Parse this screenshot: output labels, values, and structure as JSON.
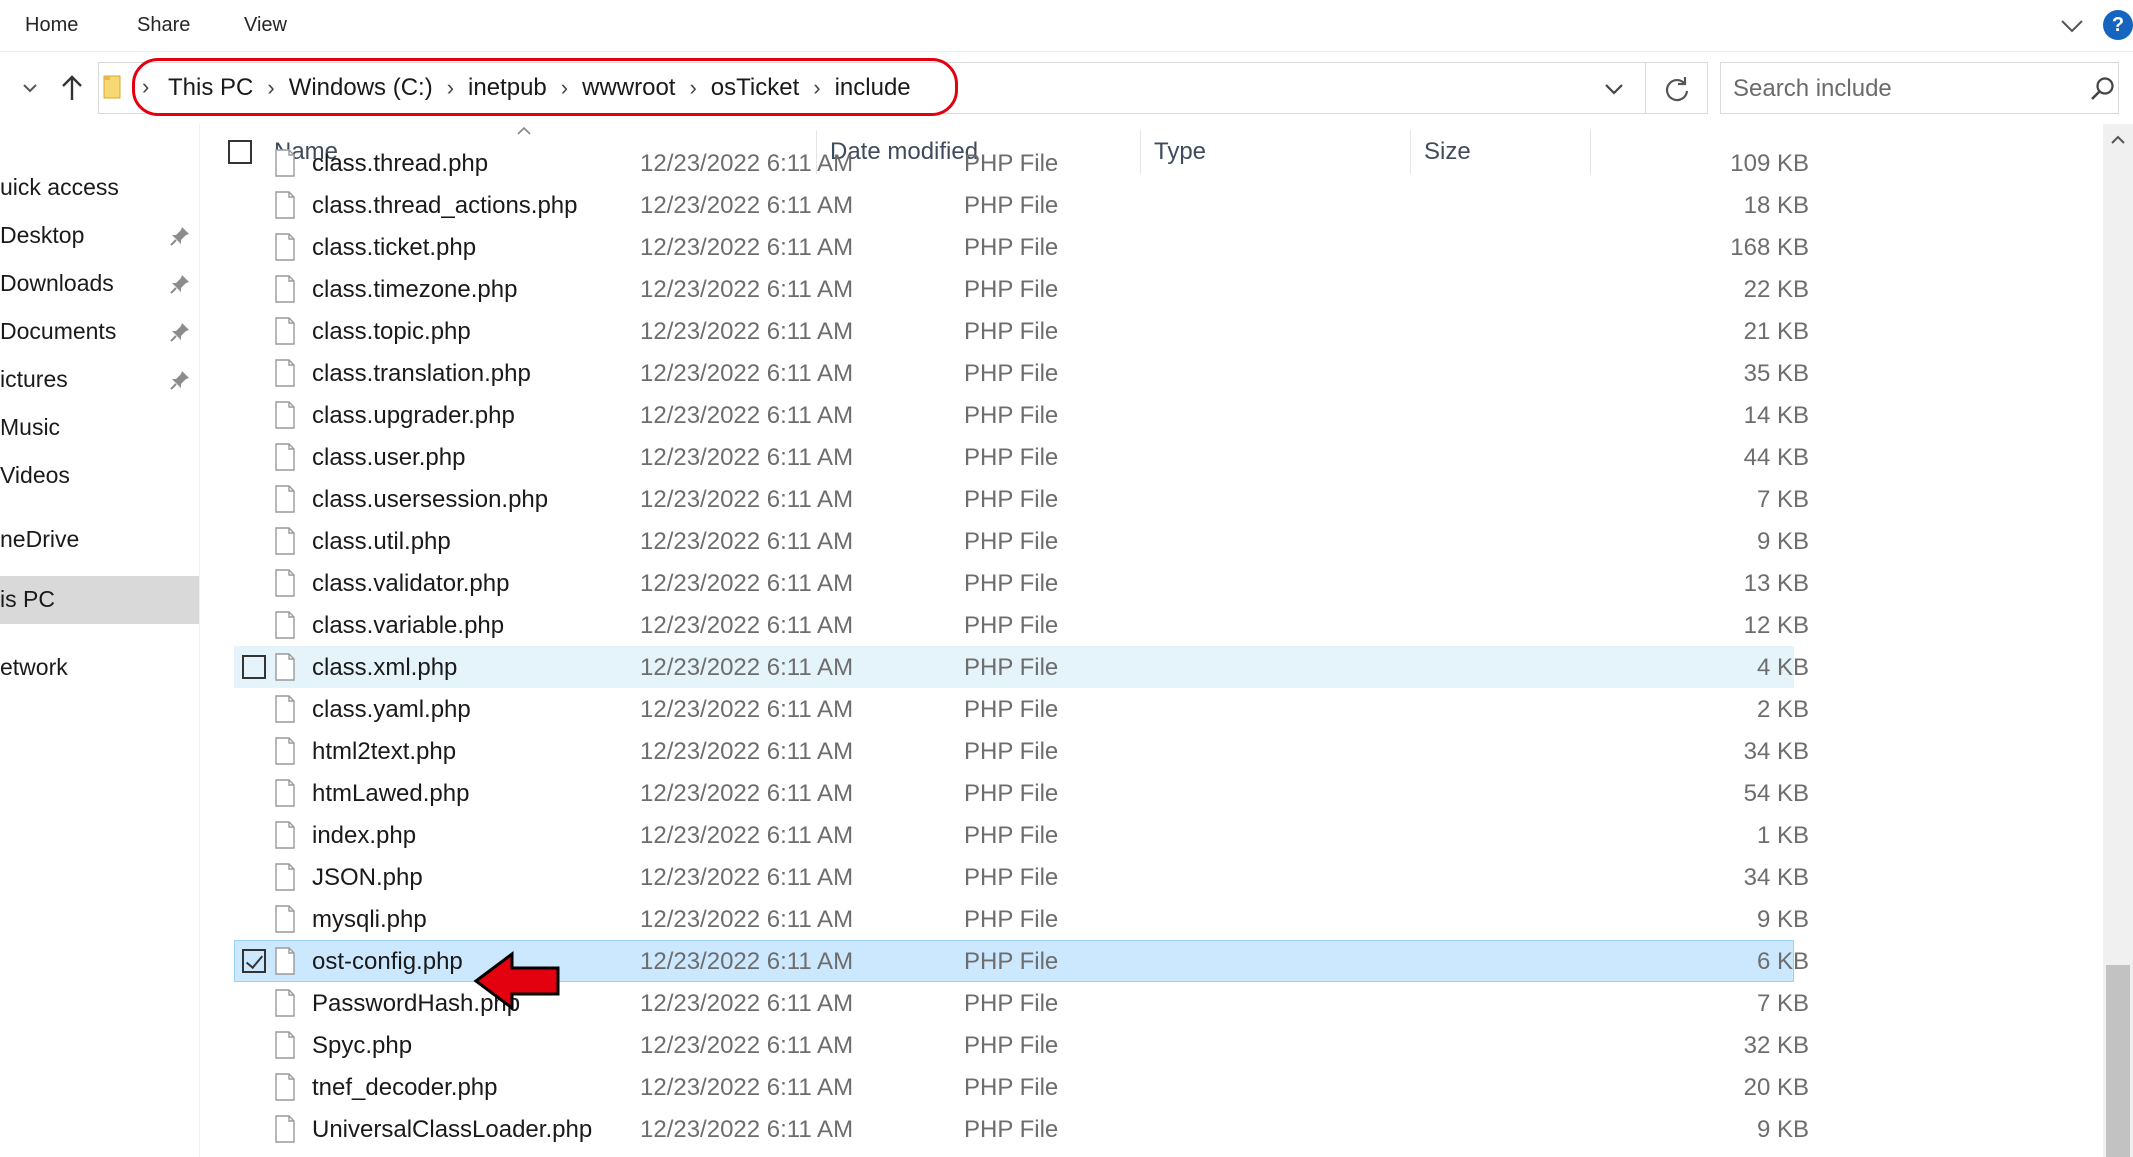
{
  "ribbon": {
    "tabs": [
      "Home",
      "Share",
      "View"
    ],
    "help_label": "?"
  },
  "address": {
    "breadcrumbs": [
      "This PC",
      "Windows (C:)",
      "inetpub",
      "wwwroot",
      "osTicket",
      "include"
    ]
  },
  "search": {
    "placeholder": "Search include"
  },
  "sidebar": {
    "items": [
      {
        "label": "uick access",
        "pinned": false
      },
      {
        "label": "Desktop",
        "pinned": true
      },
      {
        "label": "Downloads",
        "pinned": true
      },
      {
        "label": "Documents",
        "pinned": true
      },
      {
        "label": "ictures",
        "pinned": true
      },
      {
        "label": "Music",
        "pinned": false
      },
      {
        "label": "Videos",
        "pinned": false
      },
      {
        "label": "neDrive",
        "pinned": false
      },
      {
        "label": "is PC",
        "pinned": false,
        "selected": true
      },
      {
        "label": "etwork",
        "pinned": false
      }
    ]
  },
  "columns": {
    "name": "Name",
    "date": "Date modified",
    "type": "Type",
    "size": "Size"
  },
  "files": [
    {
      "name": "class.thread.php",
      "date": "12/23/2022 6:11 AM",
      "type": "PHP File",
      "size": "109 KB"
    },
    {
      "name": "class.thread_actions.php",
      "date": "12/23/2022 6:11 AM",
      "type": "PHP File",
      "size": "18 KB"
    },
    {
      "name": "class.ticket.php",
      "date": "12/23/2022 6:11 AM",
      "type": "PHP File",
      "size": "168 KB"
    },
    {
      "name": "class.timezone.php",
      "date": "12/23/2022 6:11 AM",
      "type": "PHP File",
      "size": "22 KB"
    },
    {
      "name": "class.topic.php",
      "date": "12/23/2022 6:11 AM",
      "type": "PHP File",
      "size": "21 KB"
    },
    {
      "name": "class.translation.php",
      "date": "12/23/2022 6:11 AM",
      "type": "PHP File",
      "size": "35 KB"
    },
    {
      "name": "class.upgrader.php",
      "date": "12/23/2022 6:11 AM",
      "type": "PHP File",
      "size": "14 KB"
    },
    {
      "name": "class.user.php",
      "date": "12/23/2022 6:11 AM",
      "type": "PHP File",
      "size": "44 KB"
    },
    {
      "name": "class.usersession.php",
      "date": "12/23/2022 6:11 AM",
      "type": "PHP File",
      "size": "7 KB"
    },
    {
      "name": "class.util.php",
      "date": "12/23/2022 6:11 AM",
      "type": "PHP File",
      "size": "9 KB"
    },
    {
      "name": "class.validator.php",
      "date": "12/23/2022 6:11 AM",
      "type": "PHP File",
      "size": "13 KB"
    },
    {
      "name": "class.variable.php",
      "date": "12/23/2022 6:11 AM",
      "type": "PHP File",
      "size": "12 KB"
    },
    {
      "name": "class.xml.php",
      "date": "12/23/2022 6:11 AM",
      "type": "PHP File",
      "size": "4 KB",
      "state": "hover"
    },
    {
      "name": "class.yaml.php",
      "date": "12/23/2022 6:11 AM",
      "type": "PHP File",
      "size": "2 KB"
    },
    {
      "name": "html2text.php",
      "date": "12/23/2022 6:11 AM",
      "type": "PHP File",
      "size": "34 KB"
    },
    {
      "name": "htmLawed.php",
      "date": "12/23/2022 6:11 AM",
      "type": "PHP File",
      "size": "54 KB"
    },
    {
      "name": "index.php",
      "date": "12/23/2022 6:11 AM",
      "type": "PHP File",
      "size": "1 KB"
    },
    {
      "name": "JSON.php",
      "date": "12/23/2022 6:11 AM",
      "type": "PHP File",
      "size": "34 KB"
    },
    {
      "name": "mysqli.php",
      "date": "12/23/2022 6:11 AM",
      "type": "PHP File",
      "size": "9 KB"
    },
    {
      "name": "ost-config.php",
      "date": "12/23/2022 6:11 AM",
      "type": "PHP File",
      "size": "6 KB",
      "state": "selected"
    },
    {
      "name": "PasswordHash.php",
      "date": "12/23/2022 6:11 AM",
      "type": "PHP File",
      "size": "7 KB"
    },
    {
      "name": "Spyc.php",
      "date": "12/23/2022 6:11 AM",
      "type": "PHP File",
      "size": "32 KB"
    },
    {
      "name": "tnef_decoder.php",
      "date": "12/23/2022 6:11 AM",
      "type": "PHP File",
      "size": "20 KB"
    },
    {
      "name": "UniversalClassLoader.php",
      "date": "12/23/2022 6:11 AM",
      "type": "PHP File",
      "size": "9 KB"
    }
  ],
  "colors": {
    "accent_annotation": "#e3000f",
    "selected_row": "#cce8ff",
    "hover_row": "#e5f3fb",
    "help_button": "#1565c0"
  }
}
